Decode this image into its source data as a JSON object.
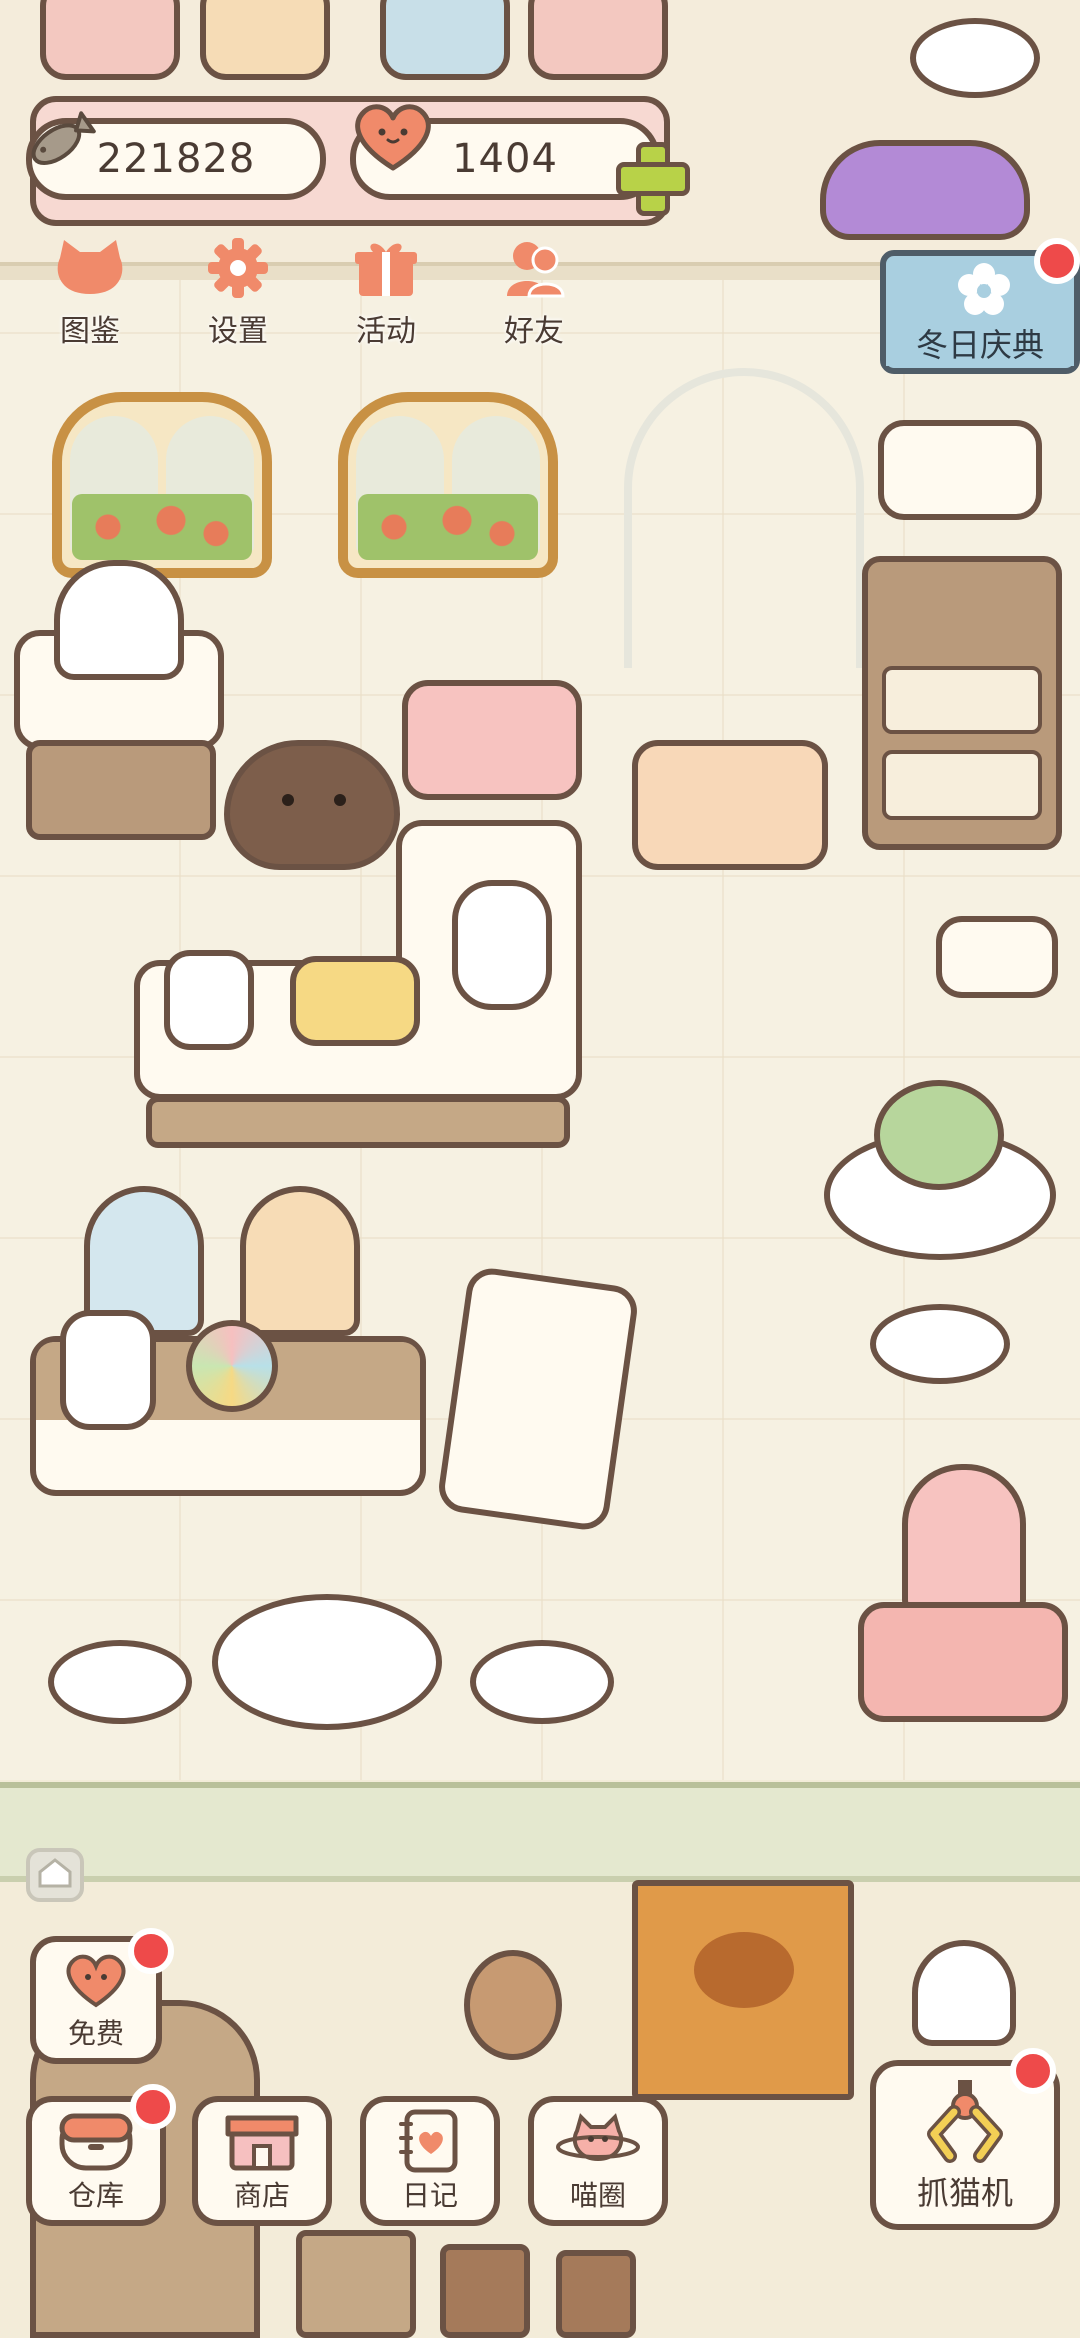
{
  "currencies": {
    "fish": "221828",
    "hearts": "1404"
  },
  "menu": [
    {
      "label": "图鉴",
      "icon": "cat-head-icon"
    },
    {
      "label": "设置",
      "icon": "gear-icon"
    },
    {
      "label": "活动",
      "icon": "gift-icon"
    },
    {
      "label": "好友",
      "icon": "friends-icon"
    }
  ],
  "event": {
    "label": "冬日庆典",
    "icon": "flower-icon"
  },
  "bottom_bar": {
    "free": "免费",
    "warehouse": "仓库",
    "shop": "商店",
    "diary": "日记",
    "meow_circle": "喵圈",
    "claw_machine": "抓猫机"
  },
  "colors": {
    "outline": "#6b5244",
    "badge": "#ee4a4a",
    "accent_orange": "#f08a6a",
    "plus_green": "#b8d248"
  }
}
